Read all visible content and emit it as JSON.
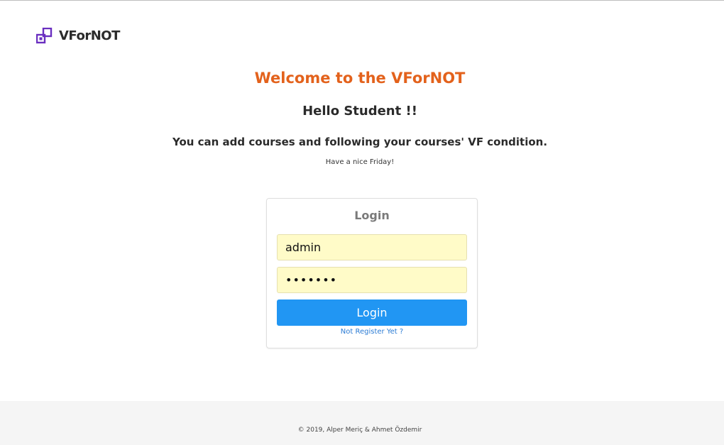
{
  "brand": {
    "name": "VForNOT",
    "logo_icon": "nested-squares-icon",
    "logo_color": "#6a2fc0"
  },
  "hero": {
    "title": "Welcome to the VForNOT",
    "title_color": "#e3621c",
    "greeting": "Hello Student !!",
    "subtitle": "You can add courses and following your courses' VF condition.",
    "note": "Have a nice Friday!"
  },
  "login": {
    "title": "Login",
    "username_value": "admin",
    "password_value": "•••••••",
    "button_label": "Login",
    "button_color": "#2196f3",
    "register_link": "Not Register Yet ?"
  },
  "footer": {
    "text": "© 2019, Alper Meriç & Ahmet Özdemir"
  }
}
